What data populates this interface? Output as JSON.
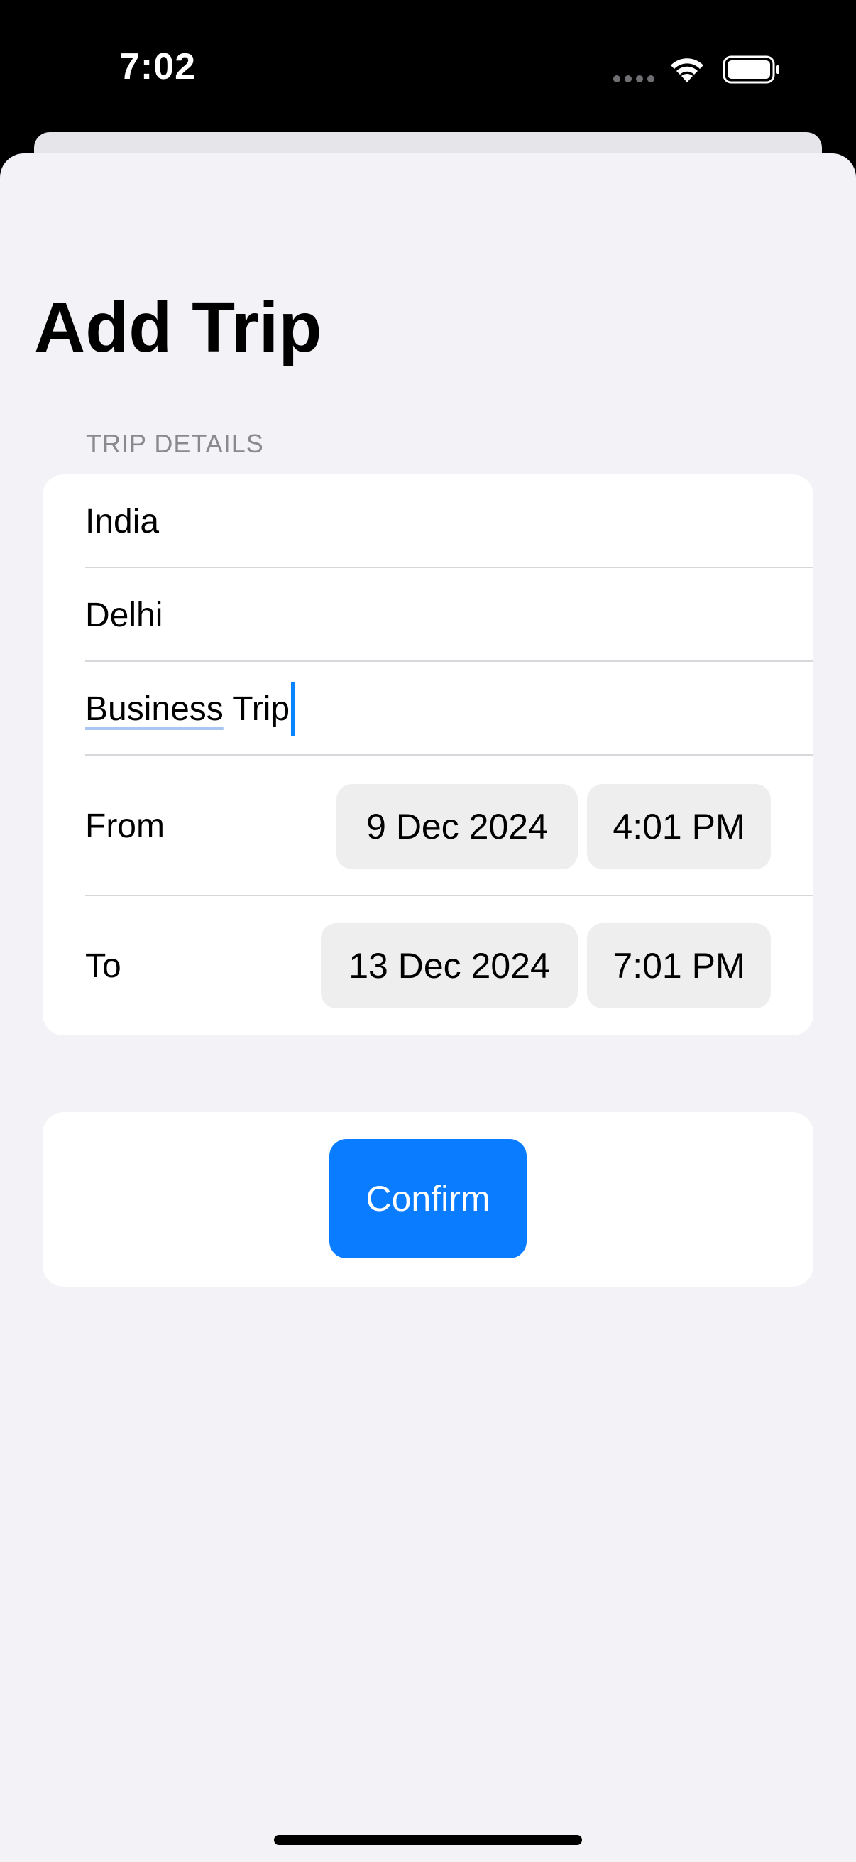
{
  "status_bar": {
    "time": "7:02"
  },
  "header": {
    "title": "Add Trip"
  },
  "trip_details": {
    "section_title": "TRIP DETAILS",
    "country": "India",
    "city": "Delhi",
    "purpose_underlined": "Business",
    "purpose_rest": " Trip",
    "from": {
      "label": "From",
      "date": "9 Dec 2024",
      "time": "4:01 PM"
    },
    "to": {
      "label": "To",
      "date": "13 Dec 2024",
      "time": "7:01 PM"
    }
  },
  "actions": {
    "confirm_label": "Confirm"
  },
  "colors": {
    "accent": "#0a7cff",
    "background": "#f2f2f7",
    "card": "#ffffff",
    "pill": "#eeeeef",
    "secondary_text": "#8a8a8e"
  },
  "icons": [
    "signal-icon",
    "wifi-icon",
    "battery-icon"
  ]
}
